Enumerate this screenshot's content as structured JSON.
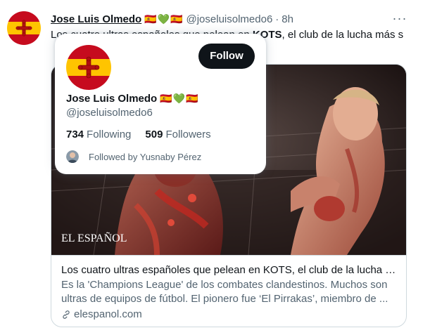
{
  "tweet": {
    "author_name": "Jose Luis Olmedo",
    "author_flags": "🇪🇸💚🇪🇸",
    "author_handle": "@joseluisolmedo6",
    "separator": "·",
    "time": "8h",
    "more_label": "···",
    "text_before": "Los cuatro ultras españoles que pelean en ",
    "text_bold": "KOTS",
    "text_after": ", el club de la lucha más s"
  },
  "card": {
    "image_overlay": "EL ESPAÑOL",
    "title": "Los cuatro ultras españoles que pelean en KOTS, el club de la lucha más ultra",
    "description": "Es la 'Champions League' de los combates clandestinos. Muchos son ultras de equipos de fútbol. El pionero fue ‘El Pirrakas’, miembro de ...",
    "domain": "elespanol.com"
  },
  "hovercard": {
    "follow_label": "Follow",
    "name": "Jose Luis Olmedo",
    "flags": "🇪🇸💚🇪🇸",
    "handle": "@joseluisolmedo6",
    "following_count": "734",
    "following_label": "Following",
    "followers_count": "509",
    "followers_label": "Followers",
    "followed_by": "Followed by Yusnaby Pérez"
  },
  "icons": {
    "avatar": "castilla-cross-flag-avatar",
    "more": "more-dots-icon",
    "link": "link-icon"
  },
  "colors": {
    "primary_text": "#0f1419",
    "secondary_text": "#536471",
    "follow_button": "#0f1419",
    "border": "#cfd9de",
    "flag_red": "#c60b1e",
    "flag_yellow": "#ffc400"
  }
}
